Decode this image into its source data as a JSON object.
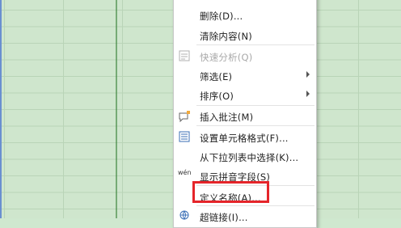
{
  "menu": {
    "items": [
      {
        "label": "删除(D)...",
        "disabled": false,
        "submenu": false,
        "icon": ""
      },
      {
        "label": "清除内容(N)",
        "disabled": false,
        "submenu": false,
        "icon": ""
      },
      {
        "label": "快速分析(Q)",
        "disabled": true,
        "submenu": false,
        "icon": "quick-analysis-icon"
      },
      {
        "label": "筛选(E)",
        "disabled": false,
        "submenu": true,
        "icon": ""
      },
      {
        "label": "排序(O)",
        "disabled": false,
        "submenu": true,
        "icon": ""
      },
      {
        "label": "插入批注(M)",
        "disabled": false,
        "submenu": false,
        "icon": "comment-icon"
      },
      {
        "label": "设置单元格格式(F)...",
        "disabled": false,
        "submenu": false,
        "icon": "format-cells-icon"
      },
      {
        "label": "从下拉列表中选择(K)...",
        "disabled": false,
        "submenu": false,
        "icon": ""
      },
      {
        "label": "显示拼音字段(S)",
        "disabled": false,
        "submenu": false,
        "icon": "phonetic-icon"
      },
      {
        "label": "定义名称(A)...",
        "disabled": false,
        "submenu": false,
        "icon": ""
      },
      {
        "label": "超链接(I)...",
        "disabled": false,
        "submenu": false,
        "icon": "hyperlink-icon"
      }
    ],
    "phonetic_icon_text": "wén"
  },
  "colors": {
    "sheet_bg": "#cfe6cd",
    "highlight": "#e5252a"
  }
}
